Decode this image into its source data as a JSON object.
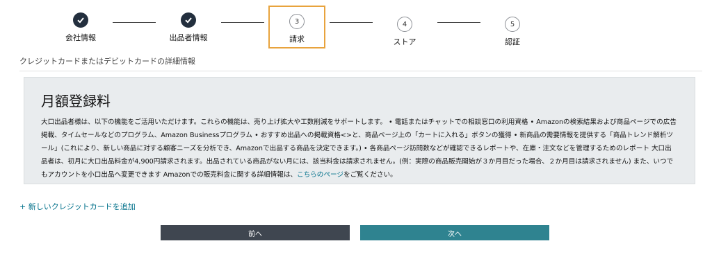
{
  "stepper": {
    "steps": [
      {
        "label": "会社情報",
        "number": "",
        "state": "done"
      },
      {
        "label": "出品者情報",
        "number": "",
        "state": "done"
      },
      {
        "label": "請求",
        "number": "3",
        "state": "active"
      },
      {
        "label": "ストア",
        "number": "4",
        "state": "todo"
      },
      {
        "label": "認証",
        "number": "5",
        "state": "todo"
      }
    ]
  },
  "section_subtitle": "クレジットカードまたはデビットカードの詳細情報",
  "fee_panel": {
    "title": "月額登録料",
    "body_text": "大口出品者様は、以下の機能をご活用いただけます。これらの機能は、売り上げ拡大や工数削減をサポートします。 • 電話またはチャットでの相談窓口の利用資格 • Amazonの検索結果および商品ページでの広告掲載、タイムセールなどのプログラム、Amazon Businessプログラム • おすすめ出品への掲載資格<>と、商品ページ上の「カートに入れる」ボタンの獲得 • 新商品の需要情報を提供する「商品トレンド解析ツール」(これにより、新しい商品に対する顧客ニーズを分析でき、Amazonで出品する商品を決定できます。) • 各商品ページ訪問数などが確認できるレポートや、在庫・注文などを管理するためのレポート 大口出品者は、初月に大口出品料金が4,900円請求されます。出品されている商品がない月には、該当料金は請求されません。(例：実際の商品販売開始が３か月目だった場合、２か月目は請求されません) また、いつでもアカウントを小口出品へ変更できます Amazonでの販売料金に関する詳細情報は、",
    "link_text": "こちらのページ",
    "body_suffix": "をご覧ください。"
  },
  "add_card_label": "+ 新しいクレジットカードを追加",
  "buttons": {
    "prev_label": "前へ",
    "next_label": "次へ"
  },
  "colors": {
    "active_step_border": "#e8a33d",
    "link": "#00708a",
    "prev_button": "#3f4650",
    "next_button": "#2f8390",
    "panel_bg": "#e9ecee"
  }
}
